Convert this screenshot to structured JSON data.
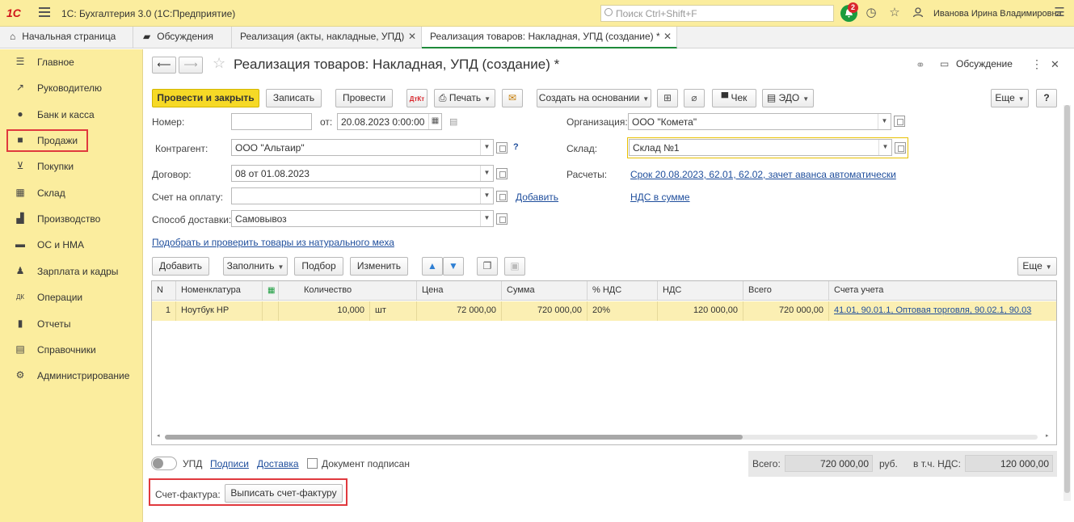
{
  "topbar": {
    "logo": "1C",
    "title": "1С: Бухгалтерия 3.0  (1С:Предприятие)",
    "search_placeholder": "Поиск Ctrl+Shift+F",
    "notifications_count": "2",
    "user": "Иванова Ирина Владимировна"
  },
  "tabs": [
    {
      "label": "Начальная страница"
    },
    {
      "label": "Обсуждения"
    },
    {
      "label": "Реализация (акты, накладные, УПД)"
    },
    {
      "label": "Реализация товаров: Накладная, УПД (создание) *"
    }
  ],
  "sidebar": {
    "items": [
      {
        "label": "Главное"
      },
      {
        "label": "Руководителю"
      },
      {
        "label": "Банк и касса"
      },
      {
        "label": "Продажи"
      },
      {
        "label": "Покупки"
      },
      {
        "label": "Склад"
      },
      {
        "label": "Производство"
      },
      {
        "label": "ОС и НМА"
      },
      {
        "label": "Зарплата и кадры"
      },
      {
        "label": "Операции"
      },
      {
        "label": "Отчеты"
      },
      {
        "label": "Справочники"
      },
      {
        "label": "Администрирование"
      }
    ]
  },
  "doc": {
    "title": "Реализация товаров: Накладная, УПД (создание) *",
    "discuss": "Обсуждение"
  },
  "toolbar": {
    "post_close": "Провести и закрыть",
    "save": "Записать",
    "post": "Провести",
    "print": "Печать",
    "create_based": "Создать на основании",
    "check": "Чек",
    "edo": "ЭДО",
    "more": "Еще",
    "help": "?"
  },
  "form": {
    "number_label": "Номер:",
    "number_value": "",
    "date_label": "от:",
    "date_value": "20.08.2023  0:00:00",
    "org_label": "Организация:",
    "org_value": "ООО \"Комета\"",
    "counterparty_label": "Контрагент:",
    "counterparty_value": "ООО \"Альтаир\"",
    "warehouse_label": "Склад:",
    "warehouse_value": "Склад №1",
    "contract_label": "Договор:",
    "contract_value": "08 от 01.08.2023",
    "settlements_label": "Расчеты:",
    "settlements_link": "Срок 20.08.2023, 62.01, 62.02, зачет аванса автоматически",
    "invoice_pay_label": "Счет на оплату:",
    "invoice_pay_value": "",
    "add_link": "Добавить",
    "vat_link": "НДС в сумме",
    "delivery_label": "Способ доставки:",
    "delivery_value": "Самовывоз",
    "fur_link": "Подобрать и проверить товары из натурального меха"
  },
  "table_toolbar": {
    "add": "Добавить",
    "fill": "Заполнить",
    "select": "Подбор",
    "change": "Изменить",
    "more": "Еще"
  },
  "table": {
    "headers": [
      "N",
      "Номенклатура",
      "",
      "Количество",
      "Цена",
      "Сумма",
      "% НДС",
      "НДС",
      "Всего",
      "Счета учета"
    ],
    "rows": [
      {
        "n": "1",
        "item": "Ноутбук HP",
        "qty": "10,000",
        "unit": "шт",
        "price": "72 000,00",
        "sum": "720 000,00",
        "vat_rate": "20%",
        "vat": "120 000,00",
        "total": "720 000,00",
        "accounts": "41.01, 90.01.1, Оптовая торговля, 90.02.1, 90.03"
      }
    ]
  },
  "footer": {
    "upd": "УПД",
    "signatures": "Подписи",
    "delivery": "Доставка",
    "doc_signed": "Документ подписан",
    "total_label": "Всего:",
    "total_value": "720 000,00",
    "currency": "руб.",
    "vat_label": "в т.ч. НДС:",
    "vat_value": "120 000,00",
    "invoice_label": "Счет-фактура:",
    "invoice_button": "Выписать счет-фактуру"
  },
  "colors": {
    "accent_yellow": "#fbed9e",
    "primary_button": "#f6d926",
    "highlight_red": "#e0393e",
    "link_blue": "#1f4e9c",
    "active_tab_green": "#1e8a3a"
  }
}
